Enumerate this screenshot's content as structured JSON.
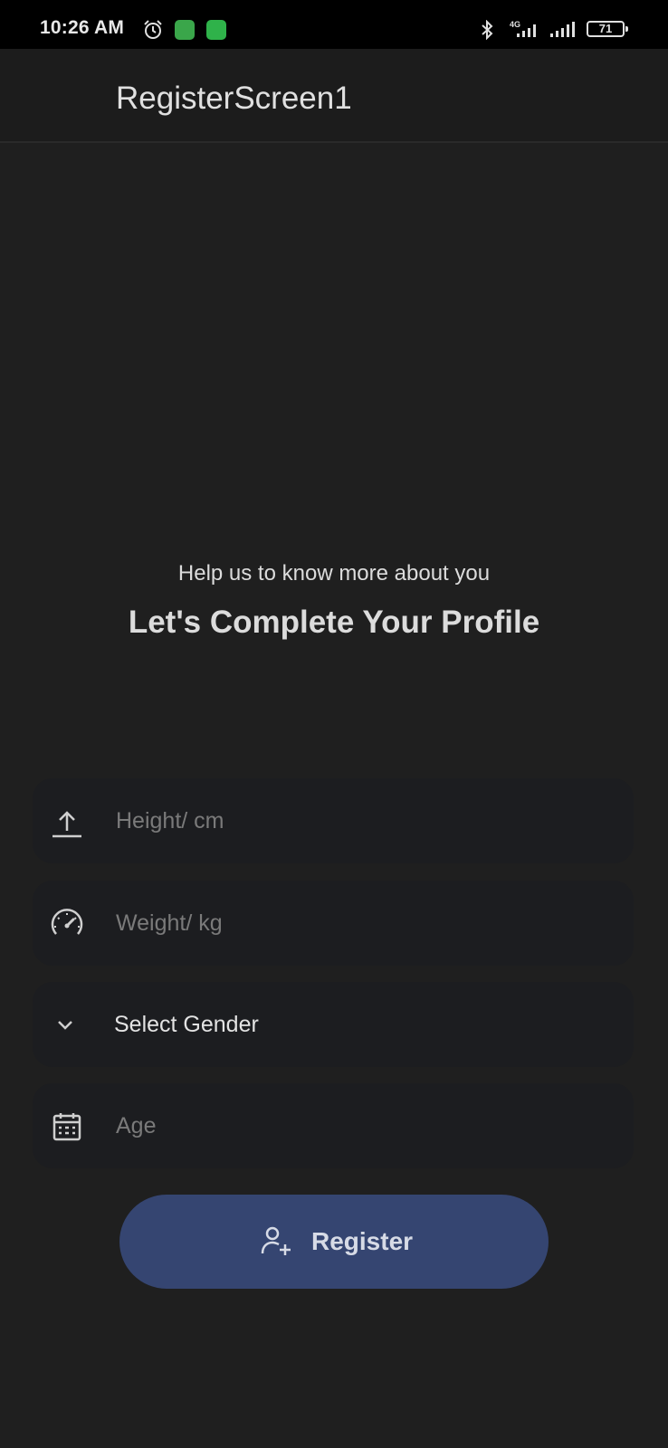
{
  "status_bar": {
    "time": "10:26 AM",
    "battery": "71",
    "network": "4G"
  },
  "app_bar": {
    "title": "RegisterScreen1"
  },
  "header": {
    "subtitle": "Help us to know more about you",
    "title": "Let's Complete Your Profile"
  },
  "form": {
    "height_placeholder": "Height/ cm",
    "weight_placeholder": "Weight/ kg",
    "gender_value": "Select Gender",
    "age_placeholder": "Age"
  },
  "register": {
    "label": "Register"
  },
  "icons": {
    "height": "upload-arrow-icon",
    "weight": "speedometer-icon",
    "gender": "chevron-down-icon",
    "age": "calendar-icon",
    "register": "add-user-icon"
  },
  "colors": {
    "background": "#1f1f1f",
    "field_background": "#1c1d20",
    "button": "#354571",
    "text": "#dcdcdc",
    "placeholder": "#7a7a7a"
  }
}
